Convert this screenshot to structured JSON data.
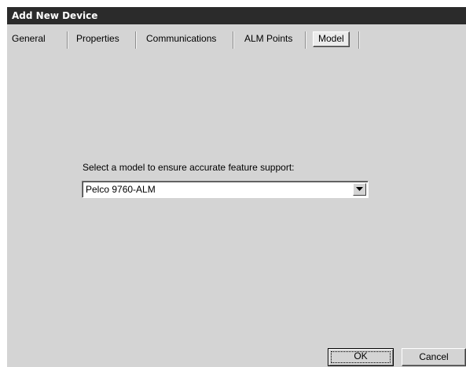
{
  "window": {
    "title": "Add New Device"
  },
  "tabs": [
    {
      "label": "General",
      "active": false
    },
    {
      "label": "Properties",
      "active": false
    },
    {
      "label": "Communications",
      "active": false
    },
    {
      "label": "ALM Points",
      "active": false
    },
    {
      "label": "Model",
      "active": true
    }
  ],
  "model": {
    "prompt": "Select a model to ensure accurate feature support:",
    "selected": "Pelco 9760-ALM",
    "arrow_icon": "dropdown-arrow-icon"
  },
  "buttons": {
    "ok": "OK",
    "cancel": "Cancel"
  }
}
